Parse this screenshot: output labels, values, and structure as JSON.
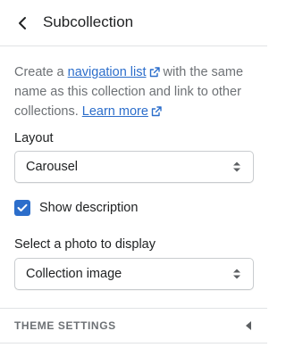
{
  "header": {
    "title": "Subcollection",
    "back_icon": "chevron-left-icon"
  },
  "description": {
    "part1": "Create a",
    "nav_link": "navigation list",
    "part2": "with the same name as this collection and link to other collections.",
    "learn_more": "Learn more",
    "link_icon": "external-link-icon"
  },
  "layout": {
    "label": "Layout",
    "value": "Carousel"
  },
  "show_description": {
    "label": "Show description",
    "checked": true
  },
  "photo": {
    "label": "Select a photo to display",
    "value": "Collection image"
  },
  "theme_settings": {
    "label": "THEME SETTINGS",
    "arrow_icon": "caret-left-icon"
  },
  "colors": {
    "accent": "#2c6ecb",
    "text": "#202223",
    "subdued": "#6d7175",
    "border": "#e1e3e5"
  }
}
